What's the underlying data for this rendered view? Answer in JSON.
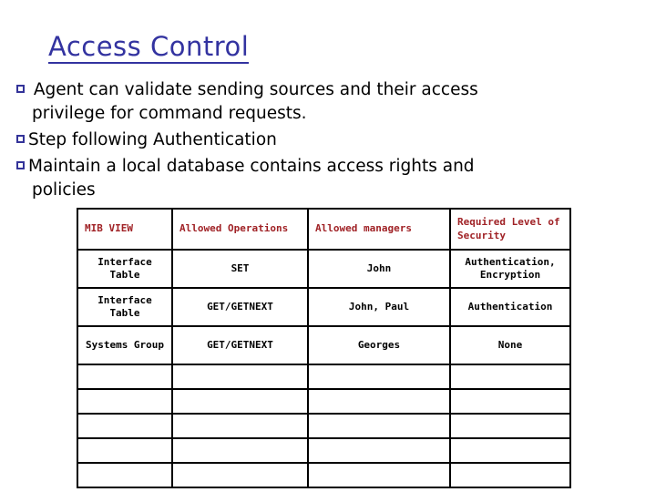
{
  "slide": {
    "title": "Access Control"
  },
  "bullets": [
    {
      "marker": "hollow-square",
      "text": " Agent can validate sending sources and their access privilege for command requests."
    },
    {
      "marker": "hollow-square",
      "text": "Step following Authentication"
    },
    {
      "marker": "hollow-square",
      "text": "Maintain a local database contains access rights and policies"
    }
  ],
  "table": {
    "headers": [
      "MIB VIEW",
      "Allowed Operations",
      "Allowed managers",
      "Required Level of Security"
    ],
    "rows": [
      {
        "mib_view": "Interface Table",
        "allowed_operations": "SET",
        "allowed_managers": "John",
        "required_level_of_security": "Authentication, Encryption"
      },
      {
        "mib_view": "Interface Table",
        "allowed_operations": "GET/GETNEXT",
        "allowed_managers": "John, Paul",
        "required_level_of_security": "Authentication"
      },
      {
        "mib_view": "Systems Group",
        "allowed_operations": "GET/GETNEXT",
        "allowed_managers": "Georges",
        "required_level_of_security": "None"
      }
    ],
    "empty_rows": 5
  },
  "colors": {
    "title": "#3333A0",
    "bullet_marker": "#333399",
    "header_text": "#A02226",
    "mib_view_text": "#333366",
    "body_text": "#000000",
    "border": "#000000",
    "background": "#FFFFFF"
  }
}
